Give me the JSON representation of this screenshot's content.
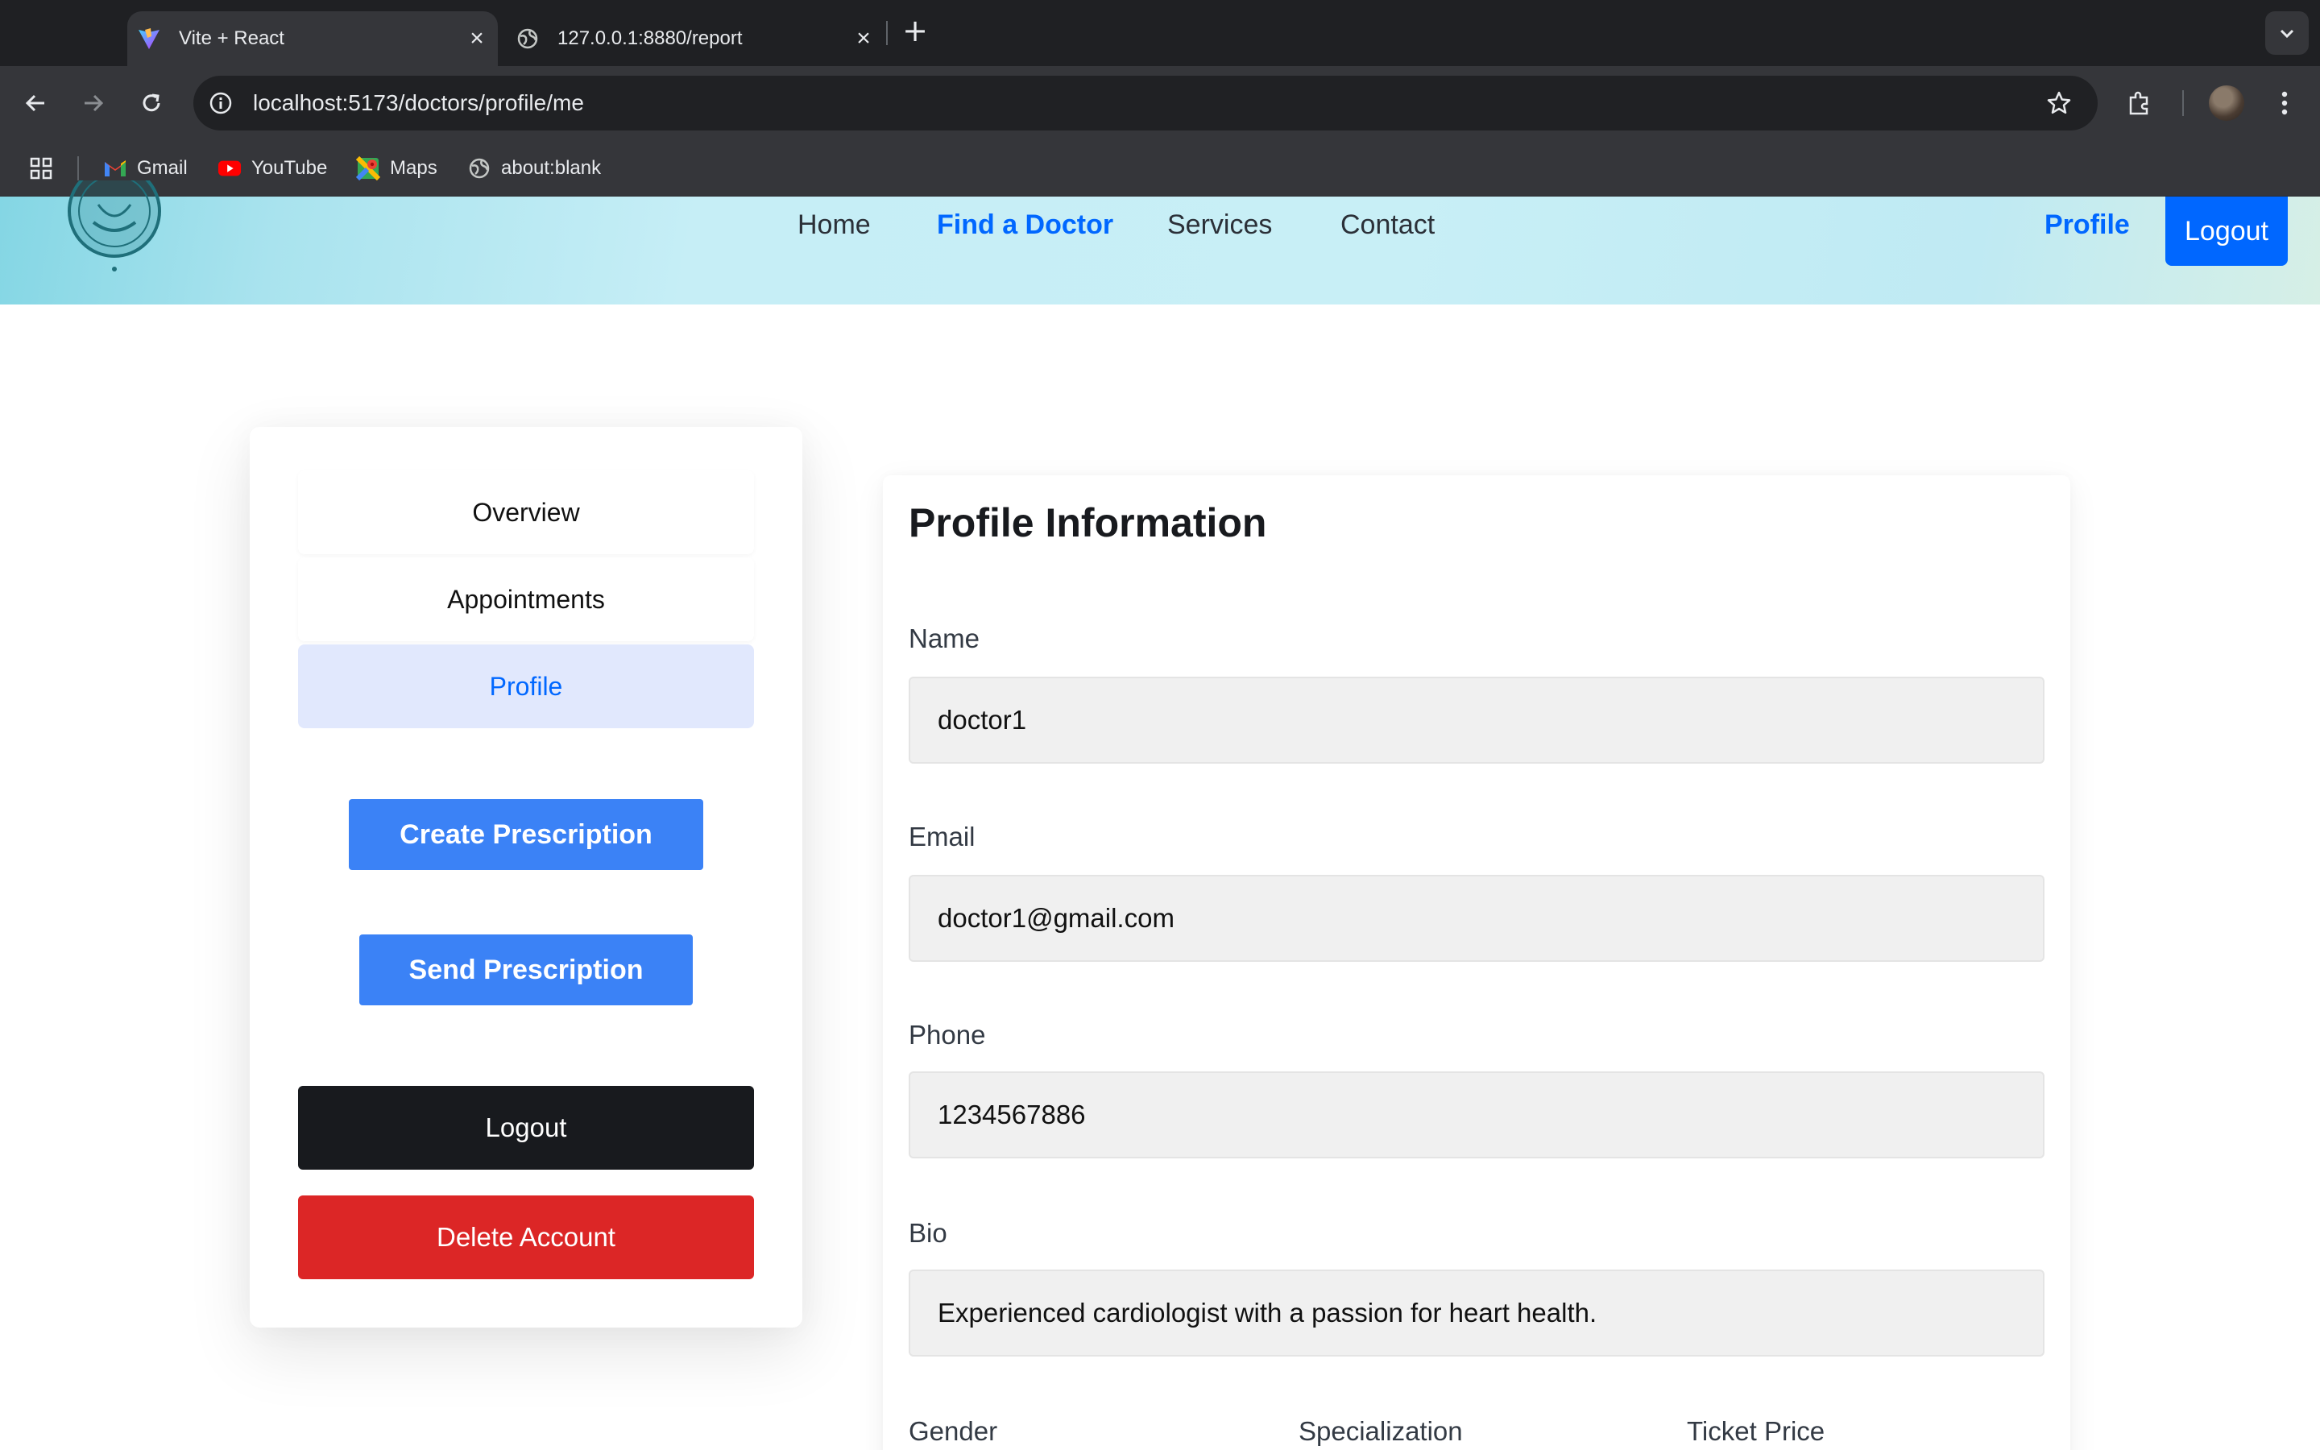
{
  "browser": {
    "tabs": [
      {
        "title": "Vite + React",
        "active": true
      },
      {
        "title": "127.0.0.1:8880/report",
        "active": false
      }
    ],
    "url": "localhost:5173/doctors/profile/me",
    "bookmarks": [
      {
        "label": "Gmail",
        "icon": "gmail-icon"
      },
      {
        "label": "YouTube",
        "icon": "youtube-icon"
      },
      {
        "label": "Maps",
        "icon": "maps-icon"
      },
      {
        "label": "about:blank",
        "icon": "globe-icon"
      }
    ]
  },
  "header": {
    "nav": [
      "Home",
      "Find a Doctor",
      "Services",
      "Contact"
    ],
    "active_nav": "Find a Doctor",
    "profile_link": "Profile",
    "logout_button": "Logout"
  },
  "sidebar": {
    "tabs": [
      "Overview",
      "Appointments",
      "Profile"
    ],
    "active_tab": "Profile",
    "create_prescription": "Create Prescription",
    "send_prescription": "Send Prescription",
    "logout": "Logout",
    "delete_account": "Delete Account"
  },
  "profile": {
    "title": "Profile Information",
    "fields": [
      {
        "label": "Name",
        "value": "doctor1"
      },
      {
        "label": "Email",
        "value": "doctor1@gmail.com"
      },
      {
        "label": "Phone",
        "value": "1234567886"
      },
      {
        "label": "Bio",
        "value": "Experienced cardiologist with a passion for heart health."
      }
    ],
    "columns": [
      "Gender",
      "Specialization",
      "Ticket Price"
    ]
  },
  "colors": {
    "brand_blue": "#0067ff",
    "button_blue": "#3b82f6",
    "danger_red": "#dc2626",
    "dark": "#181a1e",
    "active_tab_bg": "#e1e8fd"
  }
}
